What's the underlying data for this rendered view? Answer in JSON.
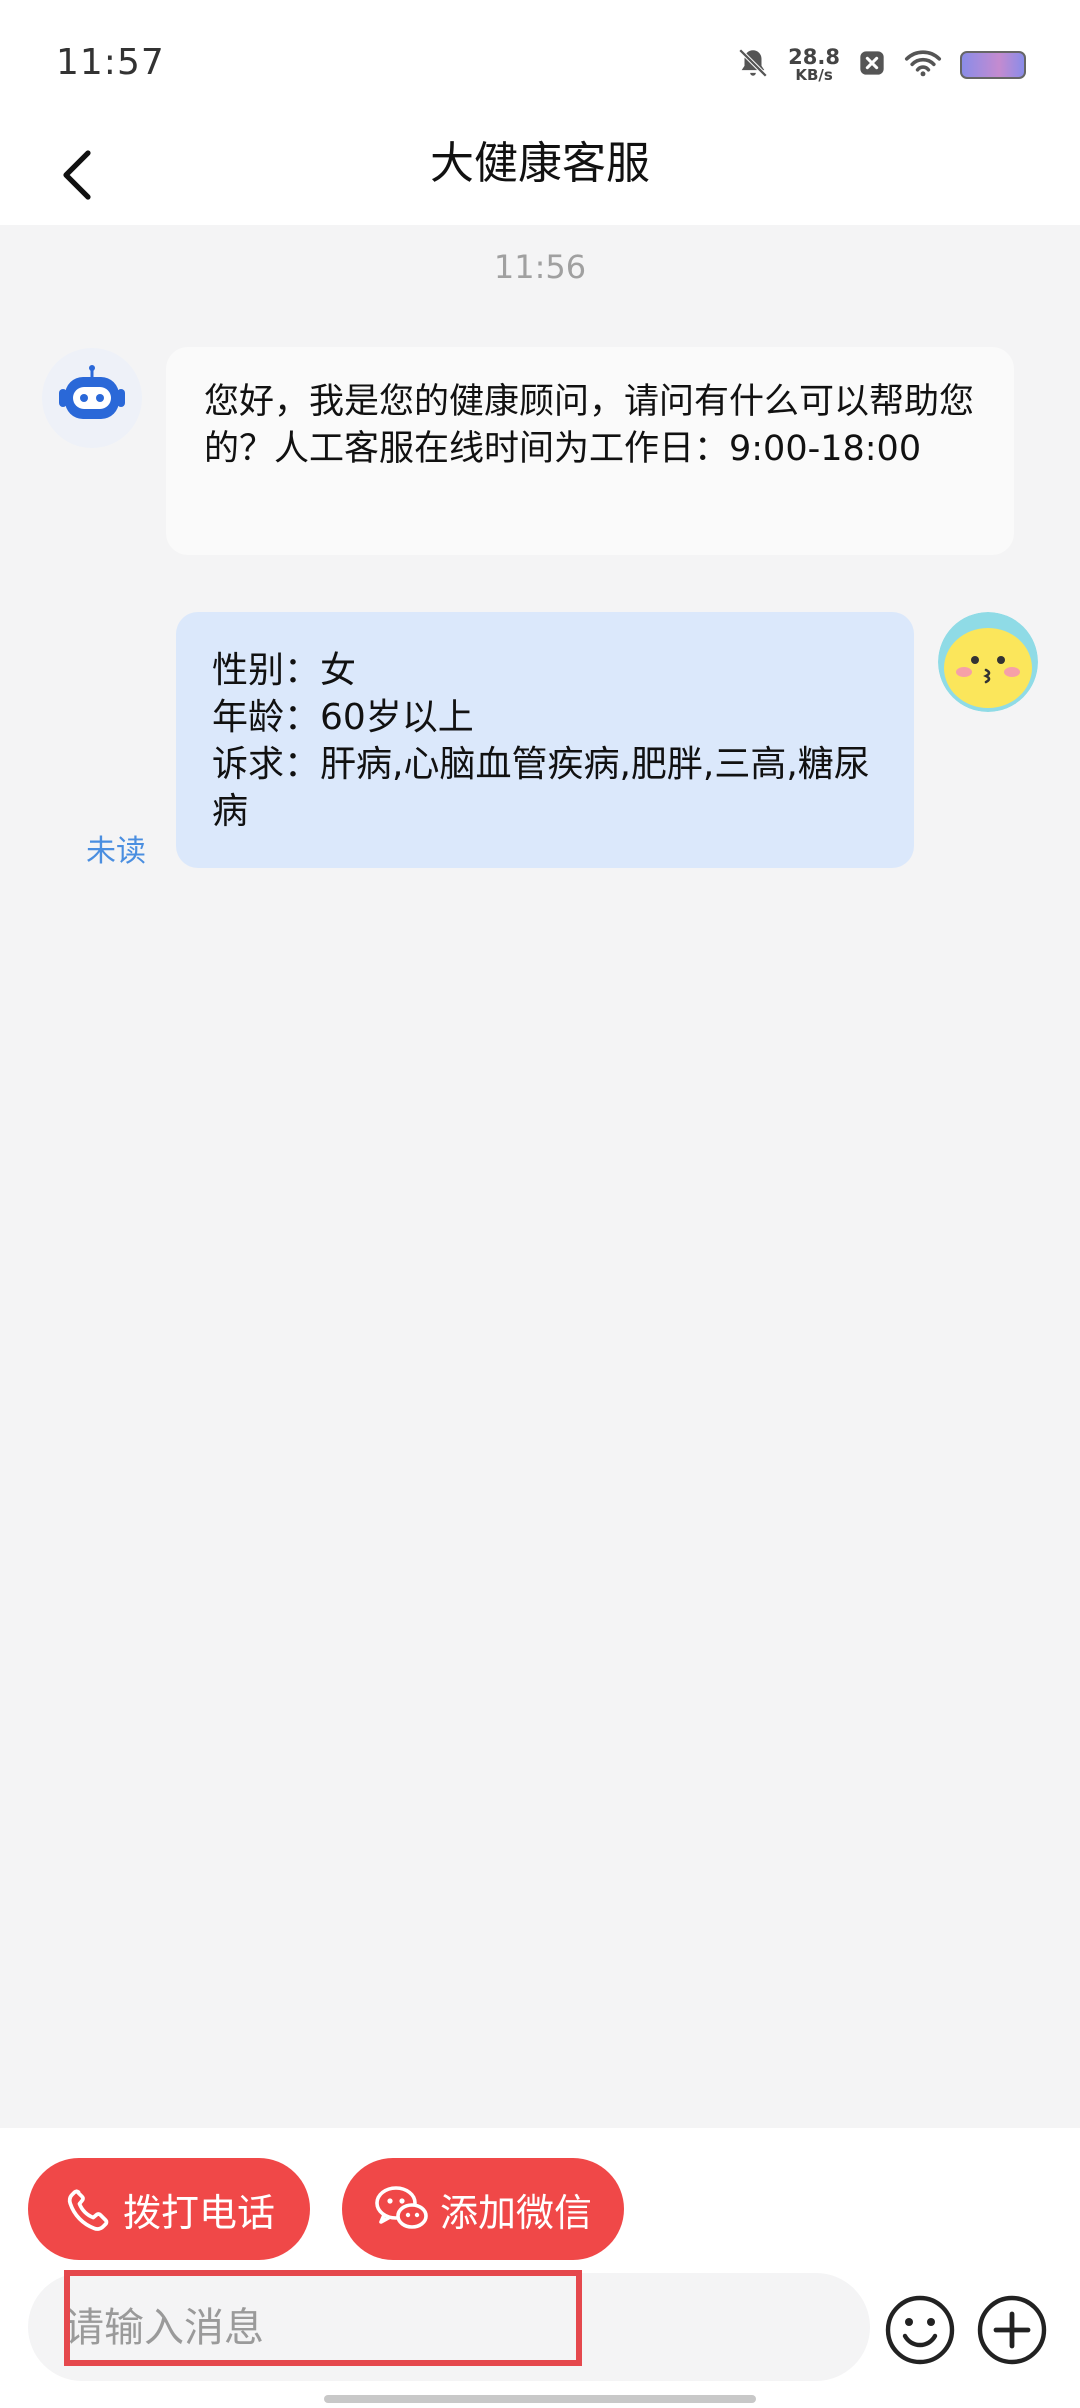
{
  "status_bar": {
    "time": "11:57",
    "net_speed_value": "28.8",
    "net_speed_unit": "KB/s",
    "icons": [
      "bell-muted-icon",
      "close-badge-icon",
      "wifi-icon",
      "battery-icon"
    ]
  },
  "header": {
    "title": "大健康客服",
    "back_icon": "chevron-left-icon"
  },
  "chat": {
    "timestamp": "11:56",
    "messages": [
      {
        "sender": "bot",
        "avatar_icon": "robot-icon",
        "text": "您好，我是您的健康顾问，请问有什么可以帮助您的？人工客服在线时间为工作日：9:00-18:00"
      },
      {
        "sender": "user",
        "avatar_icon": "kissing-face-avatar",
        "lines": [
          "性别：女",
          "年龄：60岁以上",
          "诉求：肝病,心脑血管疾病,肥胖,三高,糖尿病"
        ],
        "status": "未读"
      }
    ]
  },
  "actions": {
    "call_label": "拨打电话",
    "wechat_label": "添加微信"
  },
  "composer": {
    "placeholder": "请输入消息",
    "value": ""
  },
  "colors": {
    "accent_red": "#f04848",
    "user_bubble": "#dbe8fb",
    "bot_bubble": "#fafafa",
    "unread_blue": "#4a8ee0",
    "page_bg": "#f4f4f5"
  }
}
